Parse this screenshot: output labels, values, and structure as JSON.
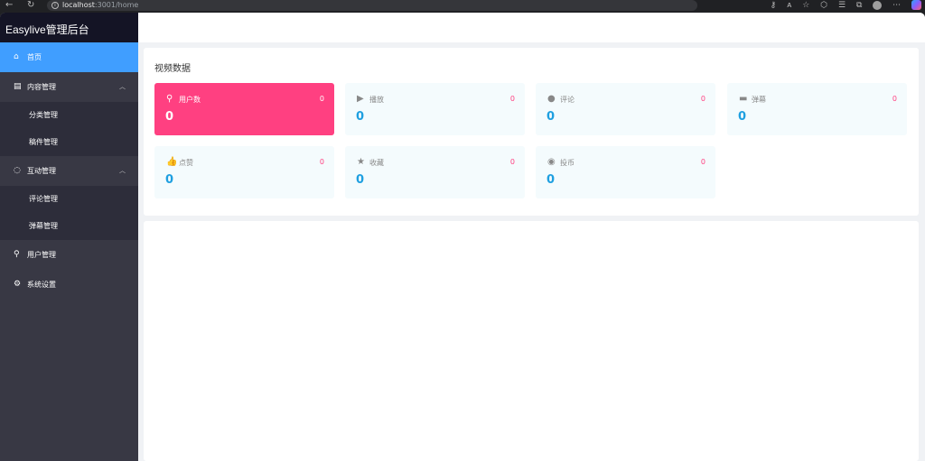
{
  "browser": {
    "url_host": "localhost",
    "url_path": ":3001/home"
  },
  "sidebar": {
    "logo": "Easylive管理后台",
    "items": [
      {
        "label": "首页",
        "icon": "home-icon"
      },
      {
        "label": "内容管理",
        "icon": "document-icon",
        "children": [
          "分类管理",
          "稿件管理"
        ]
      },
      {
        "label": "互动管理",
        "icon": "chat-icon",
        "children": [
          "评论管理",
          "弹幕管理"
        ]
      },
      {
        "label": "用户管理",
        "icon": "user-icon"
      },
      {
        "label": "系统设置",
        "icon": "gear-icon"
      }
    ]
  },
  "dashboard": {
    "title": "视频数据",
    "cards": [
      {
        "label": "用户数",
        "icon": "user-icon",
        "badge": "0",
        "value": "0"
      },
      {
        "label": "播放",
        "icon": "play-icon",
        "badge": "0",
        "value": "0"
      },
      {
        "label": "评论",
        "icon": "comment-icon",
        "badge": "0",
        "value": "0"
      },
      {
        "label": "弹幕",
        "icon": "danmaku-icon",
        "badge": "0",
        "value": "0"
      },
      {
        "label": "点赞",
        "icon": "thumbs-up-icon",
        "badge": "0",
        "value": "0"
      },
      {
        "label": "收藏",
        "icon": "star-icon",
        "badge": "0",
        "value": "0"
      },
      {
        "label": "投币",
        "icon": "coin-icon",
        "badge": "0",
        "value": "0"
      }
    ]
  },
  "colors": {
    "accent": "#409eff",
    "primary_card": "#ff4081",
    "value_blue": "#1e9fe0",
    "sidebar_bg": "#383844"
  }
}
